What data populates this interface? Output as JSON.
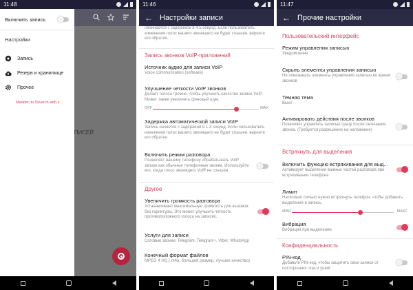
{
  "colors": {
    "accent": "#e0395a",
    "status_bar": "#1e1e36",
    "app_bar": "#2b2b45",
    "nav_bar": "#000000"
  },
  "panel1": {
    "time": "11:48",
    "drawer": {
      "record_toggle_label": "Включить запись",
      "record_toggle_on": false,
      "section_title": "Настройки",
      "items": [
        {
          "icon": "mic-icon",
          "label": "Запись"
        },
        {
          "icon": "cloud-icon",
          "label": "Резерв и хранилище"
        },
        {
          "icon": "gear-icon",
          "label": "Прочее"
        }
      ],
      "credit": "Madden to Skvarch with"
    },
    "background_text": "Х ЗАПИСЕЙ",
    "toolbar_icons": [
      "search-icon",
      "star-icon",
      "sort-icon"
    ],
    "fab_icon": "record-icon"
  },
  "panel2": {
    "time": "11:46",
    "title": "Настройки записи",
    "partial_top": "начинается с задержкой в 4.5 секунд. Если пользователь изменения голос вашего звонящего не будет слышен, верните его обратно.",
    "section_voip": "Запись звонков VoIP-приложений",
    "audio_source": {
      "title": "Источник аудио для записи VoIP",
      "subtitle": "Voice communication (software)"
    },
    "clarity": {
      "title": "Улучшение четкости VoIP звонков",
      "subtitle": "Делает голоса громче, чтобы улучшить качество записи VoIP. Может также увеличить фоновый шум.",
      "off_label": "OFF",
      "max_label": "MAX",
      "level": 0.79
    },
    "delay": {
      "title": "Задержка автоматической записи VoIP",
      "subtitle": "Запись начнется с задержкой в 1.3 секунд. Если пользователь изменения голос вашего звонящего не будет слышен, верните его обратно."
    },
    "conversation_mode": {
      "title": "Включить режим разговора",
      "subtitle": "Позволяет вашему телефону обрабатывать VoIP звонки как обычные телефонные звонки. Используйте его, когда голос звонящего VoIP не слышен.",
      "on": false
    },
    "section_other": "Другое",
    "volume": {
      "title": "Увеличить громкость разговора",
      "subtitle": "Устанавливает максимальную громкость для вызовов без гарнитуры. Это может улучшить четкость противоположного голоса на записях.",
      "on": true
    },
    "services": {
      "title": "Услуги для записи",
      "subtitle": "Сотовые звонки, Telegram, Telegram+, Viber, WhatsApp"
    },
    "format": {
      "title": "Конечный формат файлов",
      "subtitle": "MPEG 4 HQ (.m4a, большой размер, лучшее качество)"
    }
  },
  "panel3": {
    "time": "11:47",
    "title": "Прочие настройки",
    "section_ui": "Пользовательский интерфейс",
    "control_mode": {
      "title": "Режим управления записью",
      "subtitle": "Уведомление"
    },
    "hide_controls": {
      "title": "Скрыть элементы управления записью",
      "subtitle": "Не показывать элементы управления записью во время звонков",
      "on": false
    },
    "dark_theme": {
      "title": "Темная тема",
      "subtitle": "Выкл"
    },
    "after_calls": {
      "title": "Активировать действия после звонков",
      "subtitle": "Позволяет управлять записью сразу после окончания звонка. (Требуется разрешение на наложение)",
      "on": false
    },
    "section_shake": "Встряхнуть для выделения",
    "shake": {
      "title": "Включить функцию встряхивания для выд...",
      "subtitle": "Активирует выделение важных частей разговора при встряхивании телефона",
      "on": true
    },
    "limit": {
      "title": "Лимит",
      "subtitle": "Насколько сильно нужно встряхнуть телефон, чтобы добавить выделение в запись.",
      "min_label": "МИН",
      "max_label": "МАКС",
      "level": 0.67
    },
    "vibration": {
      "title": "Вибрация",
      "subtitle": "Вибрация при выделении",
      "on": true
    },
    "section_privacy": "Конфиденциальность",
    "pin": {
      "title": "PIN-код",
      "subtitle": "Добавьте PIN-код, чтобы защитить свои записи от посторонних глаз и ушей",
      "on": false
    }
  }
}
